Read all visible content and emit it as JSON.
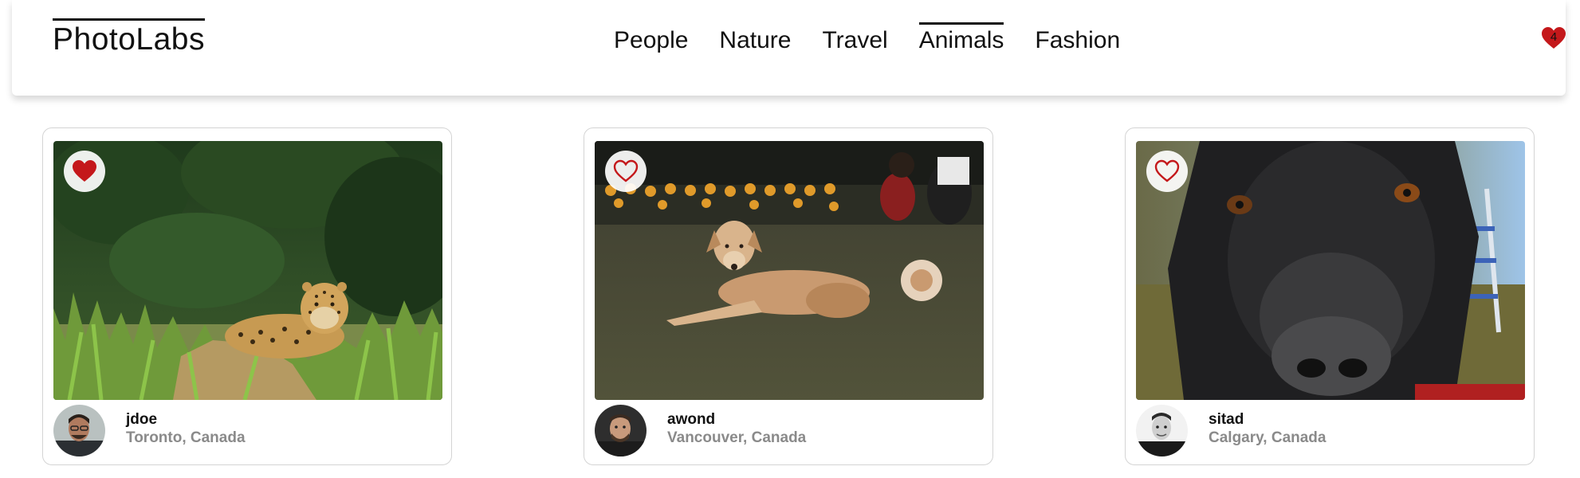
{
  "app": {
    "logo": "PhotoLabs"
  },
  "nav": {
    "topics": [
      {
        "label": "People",
        "active": false
      },
      {
        "label": "Nature",
        "active": false
      },
      {
        "label": "Travel",
        "active": false
      },
      {
        "label": "Animals",
        "active": true
      },
      {
        "label": "Fashion",
        "active": false
      }
    ],
    "favorites_count": "4"
  },
  "colors": {
    "heart_red": "#c4181b",
    "text_primary": "#111111",
    "text_muted": "#8a8a8a",
    "card_border": "#d4d4d4"
  },
  "photos": [
    {
      "subject": "jaguar-in-grass",
      "liked": true,
      "username": "jdoe",
      "location": "Toronto, Canada"
    },
    {
      "subject": "dog-lying-on-grass",
      "liked": false,
      "username": "awond",
      "location": "Vancouver, Canada"
    },
    {
      "subject": "black-dog-closeup",
      "liked": false,
      "username": "sitad",
      "location": "Calgary, Canada"
    }
  ]
}
